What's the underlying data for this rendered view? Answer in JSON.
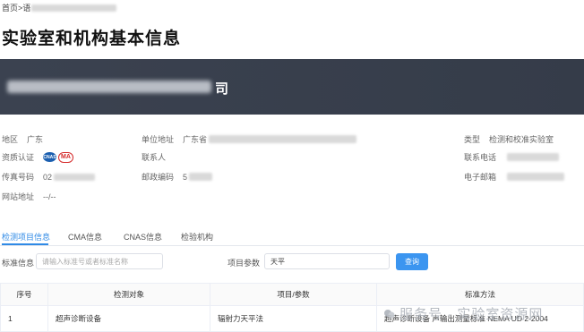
{
  "breadcrumb": {
    "home": "首页",
    "sep": ">",
    "current_first": "语"
  },
  "page": {
    "title": "实验室和机构基本信息"
  },
  "banner": {
    "visible_char": "司"
  },
  "info": {
    "region_label": "地区",
    "region_value": "广东",
    "cert_label": "资质认证",
    "fax_label": "传真号码",
    "fax_value": "02",
    "website_label": "网站地址",
    "website_value": "--/--",
    "address_label": "单位地址",
    "address_value": "广东省",
    "contact_label": "联系人",
    "postcode_label": "邮政编码",
    "postcode_value": "5",
    "type_label": "类型",
    "type_value": "检测和校准实验室",
    "phone_label": "联系电话",
    "email_label": "电子邮箱"
  },
  "tabs": [
    "检测项目信息",
    "CMA信息",
    "CNAS信息",
    "检验机构"
  ],
  "filters": {
    "standard_label": "标准信息",
    "standard_placeholder": "请输入标准号或者标准名称",
    "param_label": "项目参数",
    "param_value": "天平",
    "query_button": "查询"
  },
  "table": {
    "headers": [
      "序号",
      "检测对象",
      "项目/参数",
      "标准方法"
    ],
    "rows": [
      [
        "1",
        "超声诊断设备",
        "辐射力天平法",
        "超声诊断设备 声输出测量标准 NEMA UD 2-2004"
      ]
    ]
  },
  "watermark": {
    "text": "服务号 · 实验室资源网"
  },
  "colors": {
    "accent": "#2f8ae6",
    "banner": "#3b4250",
    "button": "#3b95f0"
  }
}
